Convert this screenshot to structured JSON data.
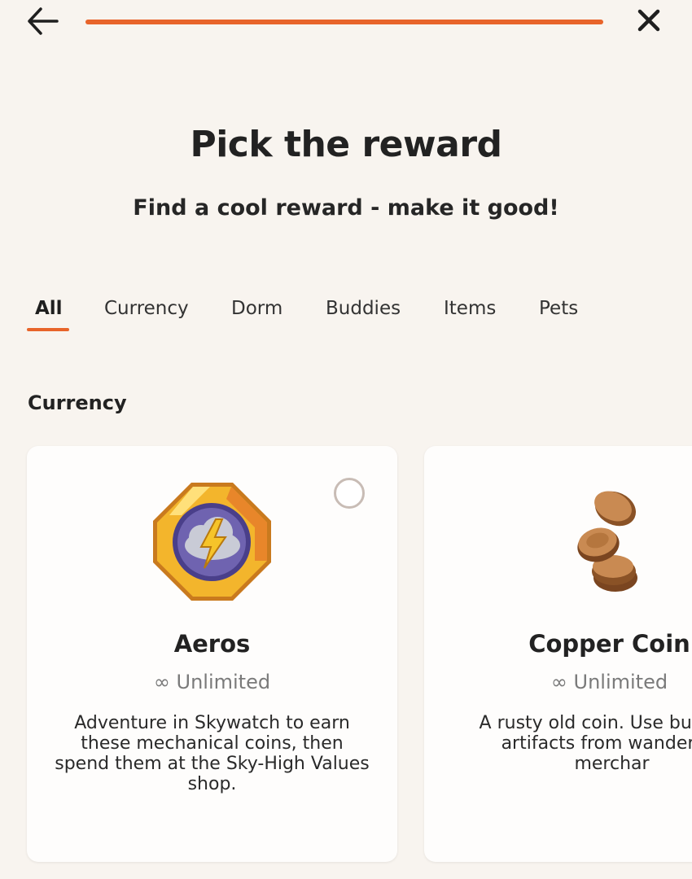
{
  "header": {
    "back_icon": "arrow-left-icon",
    "close_icon": "close-icon",
    "progress_fraction": 1.0,
    "accent_color": "#e8642a"
  },
  "title": "Pick the reward",
  "subtitle": "Find a cool reward - make it good!",
  "tabs": [
    {
      "label": "All",
      "active": true
    },
    {
      "label": "Currency",
      "active": false
    },
    {
      "label": "Dorm",
      "active": false
    },
    {
      "label": "Buddies",
      "active": false
    },
    {
      "label": "Items",
      "active": false
    },
    {
      "label": "Pets",
      "active": false
    }
  ],
  "section": {
    "heading": "Currency"
  },
  "cards": [
    {
      "name": "Aeros",
      "icon": "aeros-coin-icon",
      "quantity": "∞ Unlimited",
      "description": "Adventure in Skywatch to earn these mechanical coins, then spend them at the Sky-High Values shop.",
      "selected": false
    },
    {
      "name": "Copper Coin",
      "icon": "copper-coins-icon",
      "quantity": "∞ Unlimited",
      "description": "A rusty old coin. Use buy rare artifacts from wandering merchar",
      "selected": false
    }
  ]
}
